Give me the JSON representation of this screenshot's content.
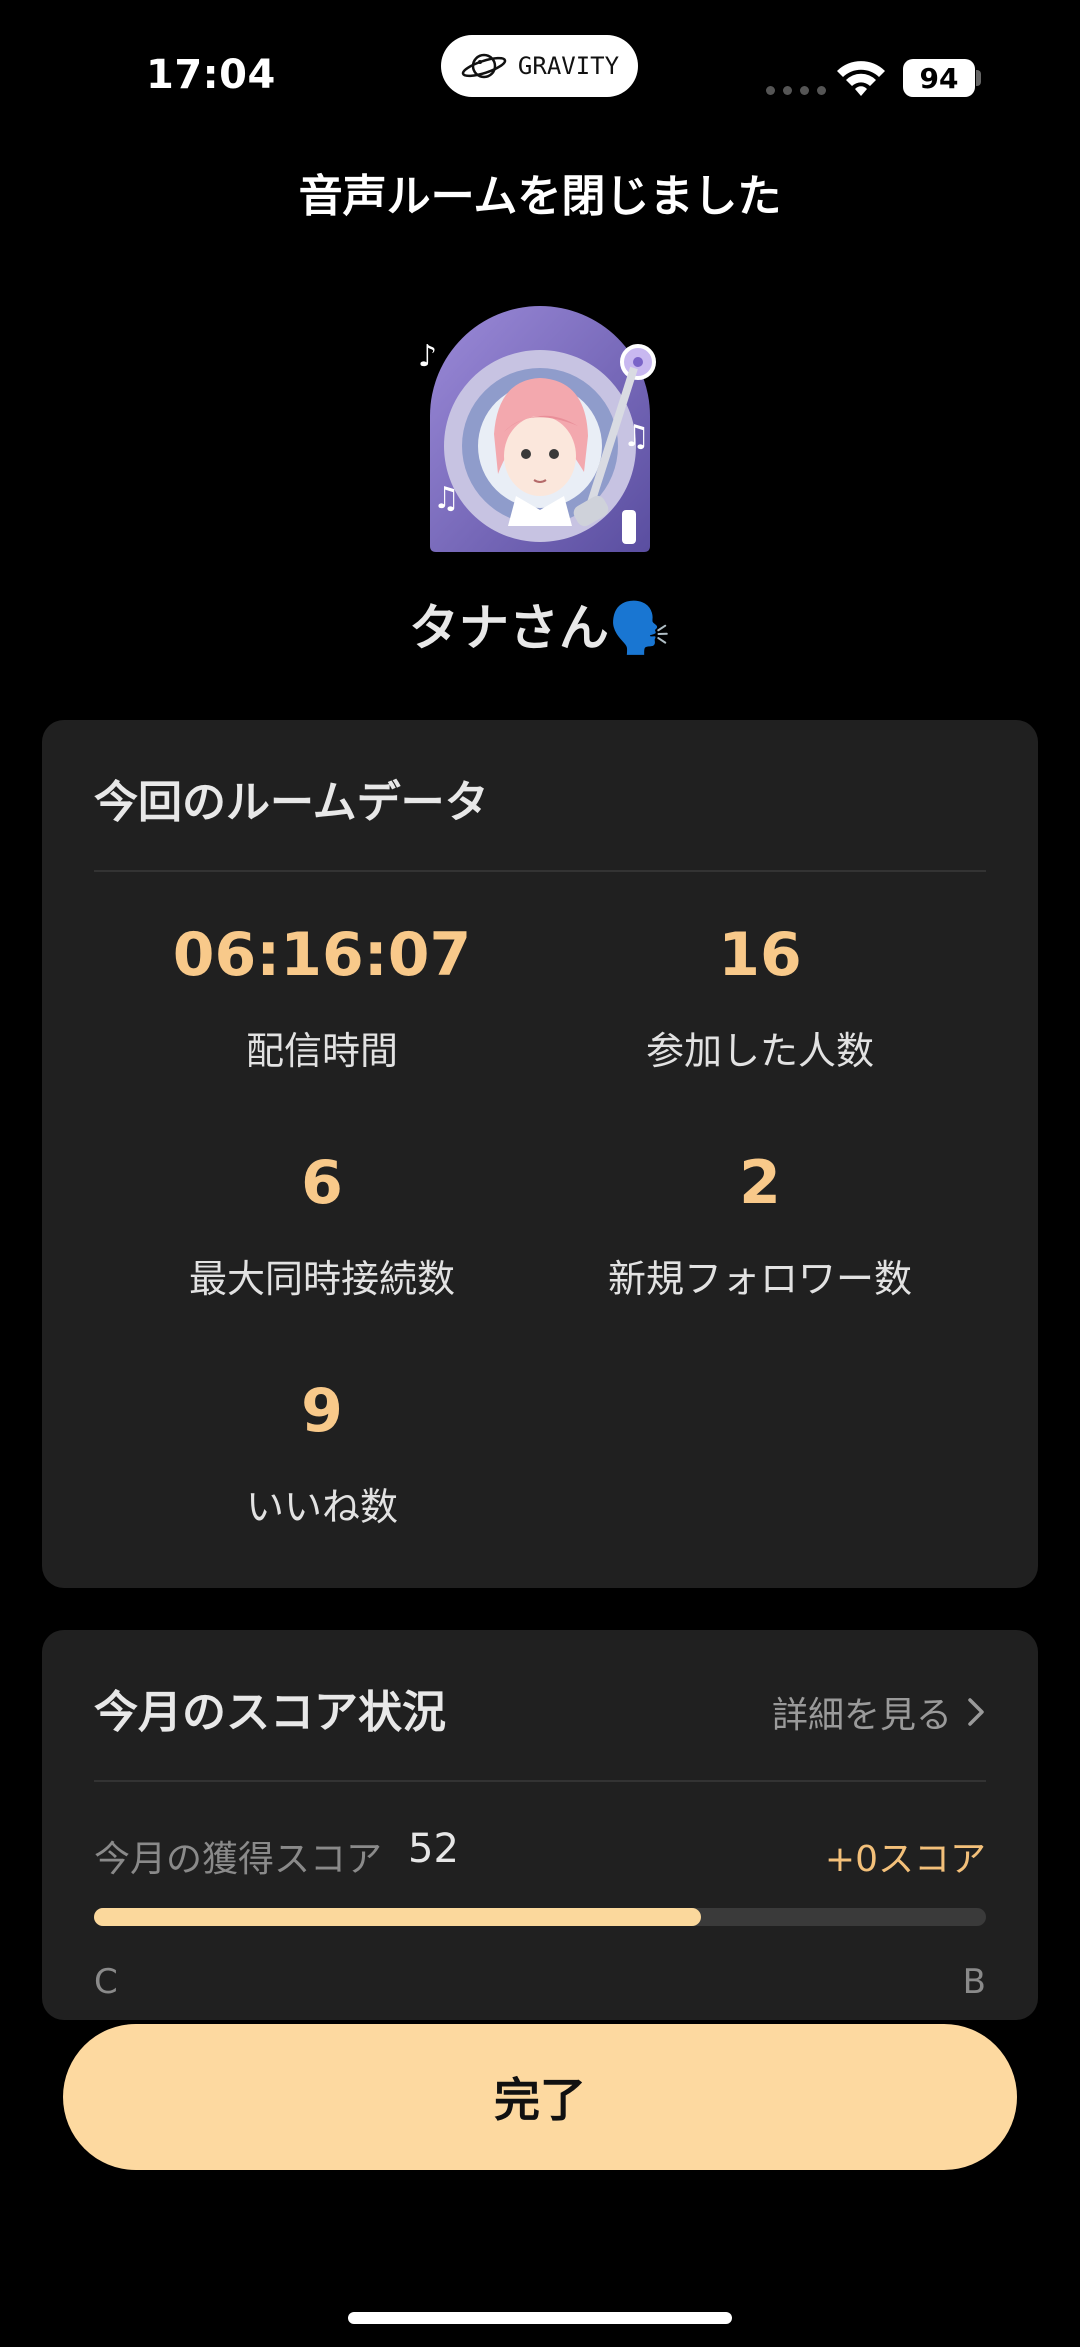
{
  "status_bar": {
    "time": "17:04",
    "app_pill": "GRAVITY",
    "battery": "94"
  },
  "page_title": "音声ルームを閉じました",
  "user": {
    "name": "タナさん🗣️"
  },
  "room_data": {
    "title": "今回のルームデータ",
    "stats": [
      {
        "value": "06:16:07",
        "label": "配信時間"
      },
      {
        "value": "16",
        "label": "参加した人数"
      },
      {
        "value": "6",
        "label": "最大同時接続数"
      },
      {
        "value": "2",
        "label": "新規フォロワー数"
      },
      {
        "value": "9",
        "label": "いいね数"
      }
    ]
  },
  "score": {
    "title": "今月のスコア状況",
    "detail_link": "詳細を見る",
    "earned_label": "今月の獲得スコア",
    "earned_value": "52",
    "delta": "+0スコア",
    "progress_fraction": 0.68,
    "grade_start": "C",
    "grade_end": "B"
  },
  "done_button": "完了",
  "colors": {
    "accent": "#f8c98a",
    "button": "#fdd9a0",
    "card": "#202020",
    "background": "#000000"
  }
}
